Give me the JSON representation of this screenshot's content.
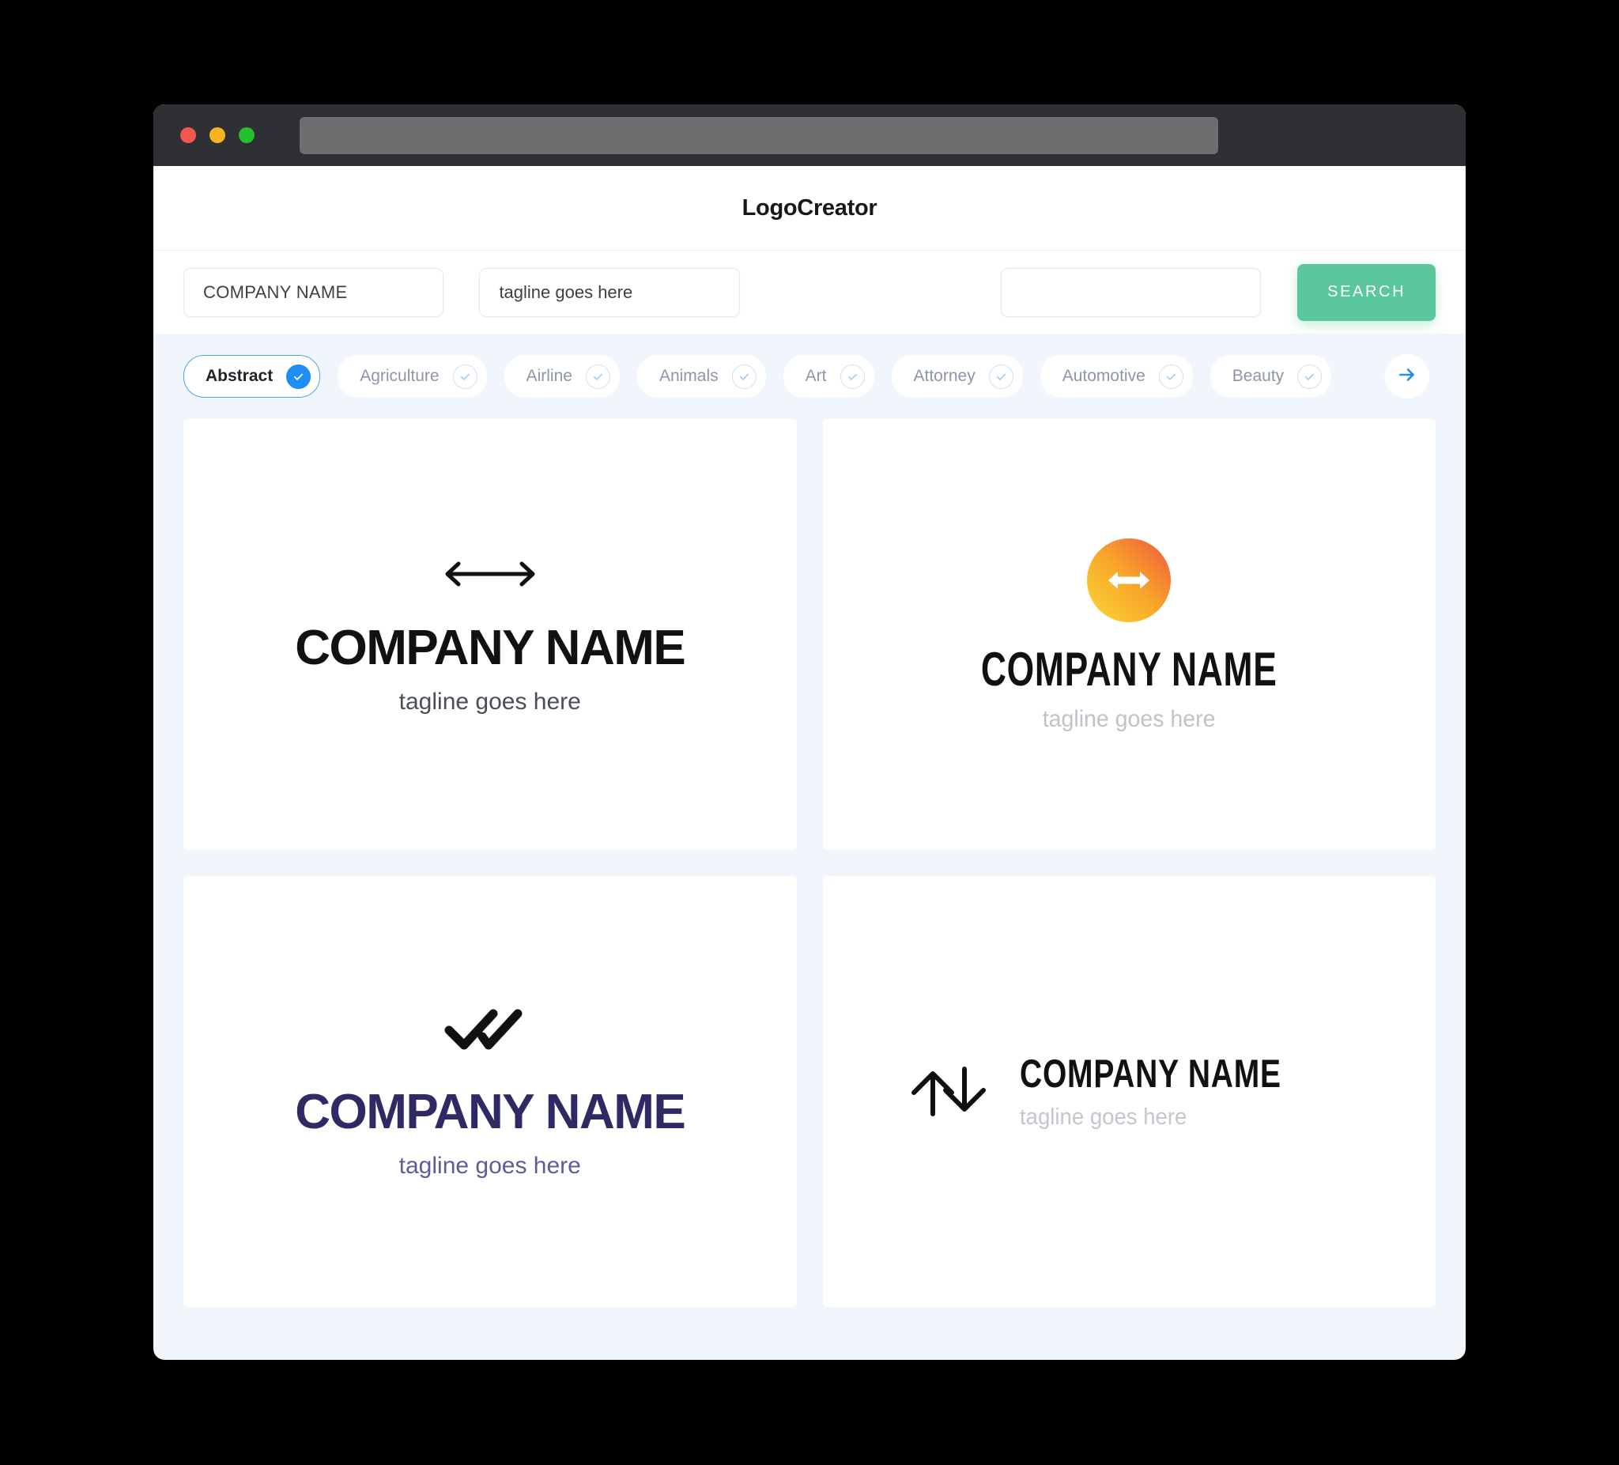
{
  "browser": {
    "traffic_lights": [
      "close-red",
      "minimize-amber",
      "maximize-green"
    ],
    "url_value": "",
    "colors": {
      "close": "#f0574f",
      "minimize": "#f7b324",
      "maximize": "#23c030",
      "chrome": "#2f3033",
      "urlbar": "#6e6e70"
    }
  },
  "header": {
    "title": "LogoCreator"
  },
  "search": {
    "company_value": "COMPANY NAME",
    "company_placeholder": "COMPANY NAME",
    "tagline_value": "tagline goes here",
    "tagline_placeholder": "tagline goes here",
    "extra_value": "",
    "extra_placeholder": "",
    "button_label": "SEARCH",
    "button_color": "#5bc79c"
  },
  "categories": {
    "selected": "Abstract",
    "accent": "#1e8ef5",
    "next_icon": "arrow-right-icon",
    "items": [
      {
        "label": "Abstract",
        "selected": true
      },
      {
        "label": "Agriculture",
        "selected": false
      },
      {
        "label": "Airline",
        "selected": false
      },
      {
        "label": "Animals",
        "selected": false
      },
      {
        "label": "Art",
        "selected": false
      },
      {
        "label": "Attorney",
        "selected": false
      },
      {
        "label": "Automotive",
        "selected": false
      },
      {
        "label": "Beauty",
        "selected": false
      }
    ]
  },
  "results": {
    "logos": [
      {
        "id": "logo-arrow-line",
        "icon": "double-headed-horizontal-arrow-icon",
        "name": "COMPANY NAME",
        "tagline": "tagline goes here",
        "name_color": "#111111",
        "tagline_color": "#4a4f57",
        "layout": "vertical"
      },
      {
        "id": "logo-gradient-circle",
        "icon": "gradient-circle-double-arrow-icon",
        "name": "COMPANY NAME",
        "tagline": "tagline goes here",
        "name_color": "#111111",
        "tagline_color": "#bfc3c9",
        "gradient_from": "#fcd736",
        "gradient_to": "#f0573c",
        "layout": "vertical"
      },
      {
        "id": "logo-double-check",
        "icon": "double-check-icon",
        "name": "COMPANY NAME",
        "tagline": "tagline goes here",
        "name_color": "#2e2a63",
        "tagline_color": "#5a5e9c",
        "layout": "vertical"
      },
      {
        "id": "logo-up-down-arrows",
        "icon": "up-down-outline-arrows-icon",
        "name": "COMPANY NAME",
        "tagline": "tagline goes here",
        "name_color": "#111111",
        "tagline_color": "#c3c6cc",
        "layout": "horizontal"
      }
    ]
  }
}
